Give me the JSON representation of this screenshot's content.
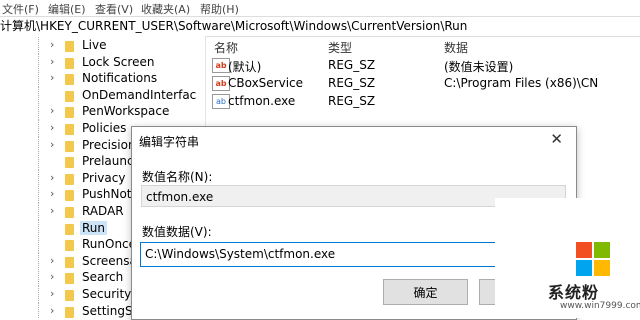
{
  "menu": [
    "文件(F)",
    "编辑(E)",
    "查看(V)",
    "收藏夹(A)",
    "帮助(H)"
  ],
  "address": "计算机\\HKEY_CURRENT_USER\\Software\\Microsoft\\Windows\\CurrentVersion\\Run",
  "tree": [
    {
      "label": "Live",
      "chev": "›"
    },
    {
      "label": "Lock Screen",
      "chev": "›"
    },
    {
      "label": "Notifications",
      "chev": "›"
    },
    {
      "label": "OnDemandInterfac",
      "chev": ""
    },
    {
      "label": "PenWorkspace",
      "chev": "›"
    },
    {
      "label": "Policies",
      "chev": "›"
    },
    {
      "label": "Precision",
      "chev": "›"
    },
    {
      "label": "Prelaunc",
      "chev": ""
    },
    {
      "label": "Privacy",
      "chev": "›"
    },
    {
      "label": "PushNot",
      "chev": "›"
    },
    {
      "label": "RADAR",
      "chev": "›"
    },
    {
      "label": "Run",
      "chev": ""
    },
    {
      "label": "RunOnce",
      "chev": ""
    },
    {
      "label": "Screensa",
      "chev": "›"
    },
    {
      "label": "Search",
      "chev": "›"
    },
    {
      "label": "Security",
      "chev": "›"
    },
    {
      "label": "SettingSy",
      "chev": "›"
    }
  ],
  "list": {
    "headers": [
      "名称",
      "类型",
      "数据"
    ],
    "rows": [
      {
        "icon": "ab",
        "name": "(默认)",
        "type": "REG_SZ",
        "data": "(数值未设置)"
      },
      {
        "icon": "ab",
        "name": "CBoxService",
        "type": "REG_SZ",
        "data": "C:\\Program Files (x86)\\CN"
      },
      {
        "icon": "ab",
        "name": "ctfmon.exe",
        "type": "REG_SZ",
        "data": ""
      }
    ]
  },
  "dialog": {
    "title": "编辑字符串",
    "close": "✕",
    "name_label": "数值名称(N):",
    "name_value": "ctfmon.exe",
    "data_label": "数值数据(V):",
    "data_value": "C:\\Windows\\System\\ctfmon.exe",
    "ok_label": "确定"
  },
  "watermark": {
    "brand": "系统粉",
    "url": "www.win7999.com",
    "colors": [
      "#f25022",
      "#7fba00",
      "#00a4ef",
      "#ffb900"
    ]
  }
}
